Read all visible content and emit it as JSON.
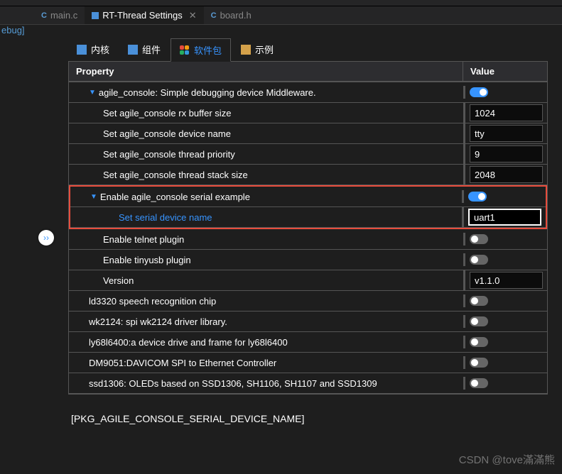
{
  "leftLabel": "ebug]",
  "fileTabs": [
    {
      "icon": "C",
      "label": "main.c",
      "closable": false,
      "active": false
    },
    {
      "icon": "RT",
      "label": "RT-Thread Settings",
      "closable": true,
      "active": true
    },
    {
      "icon": "C",
      "label": "board.h",
      "closable": false,
      "active": false
    }
  ],
  "navTabs": [
    {
      "label": "内核",
      "active": false
    },
    {
      "label": "组件",
      "active": false
    },
    {
      "label": "软件包",
      "active": true
    },
    {
      "label": "示例",
      "active": false
    }
  ],
  "headers": {
    "property": "Property",
    "value": "Value"
  },
  "rows": [
    {
      "id": "agile_console",
      "indent": 1,
      "arrow": true,
      "label": "agile_console: Simple debugging device Middleware.",
      "type": "toggle",
      "on": true
    },
    {
      "id": "rx_buf",
      "indent": 2,
      "label": "Set agile_console rx buffer size",
      "type": "input",
      "value": "1024"
    },
    {
      "id": "dev_name",
      "indent": 2,
      "label": "Set agile_console device name",
      "type": "input",
      "value": "tty"
    },
    {
      "id": "thread_prio",
      "indent": 2,
      "label": "Set agile_console thread priority",
      "type": "input",
      "value": "9"
    },
    {
      "id": "stack_size",
      "indent": 2,
      "label": "Set agile_console thread stack size",
      "type": "input",
      "value": "2048"
    },
    {
      "id": "serial_ex",
      "indent": 1,
      "arrow": true,
      "label": "Enable agile_console serial example",
      "type": "toggle",
      "on": true,
      "boxed": true
    },
    {
      "id": "serial_dev",
      "indent": 3,
      "label": "Set serial device name",
      "type": "input",
      "value": "uart1",
      "highlighted": true,
      "boxed": true,
      "focused": true
    },
    {
      "id": "telnet",
      "indent": 2,
      "label": "Enable telnet plugin",
      "type": "toggle",
      "on": false
    },
    {
      "id": "tinyusb",
      "indent": 2,
      "label": "Enable tinyusb plugin",
      "type": "toggle",
      "on": false
    },
    {
      "id": "version",
      "indent": 2,
      "label": "Version",
      "type": "input",
      "value": "v1.1.0"
    },
    {
      "id": "ld3320",
      "indent": 1,
      "label": "ld3320 speech recognition chip",
      "type": "toggle",
      "on": false
    },
    {
      "id": "wk2124",
      "indent": 1,
      "label": "wk2124: spi wk2124 driver library.",
      "type": "toggle",
      "on": false
    },
    {
      "id": "ly68l",
      "indent": 1,
      "label": "ly68l6400:a device drive and frame for ly68l6400",
      "type": "toggle",
      "on": false
    },
    {
      "id": "dm9051",
      "indent": 1,
      "label": "DM9051:DAVICOM SPI to Ethernet Controller",
      "type": "toggle",
      "on": false
    },
    {
      "id": "ssd1306",
      "indent": 1,
      "label": "ssd1306: OLEDs based on SSD1306, SH1106, SH1107 and SSD1309",
      "type": "toggle",
      "on": false
    }
  ],
  "circleBtn": "››",
  "footerKey": "[PKG_AGILE_CONSOLE_SERIAL_DEVICE_NAME]",
  "watermark": "CSDN @tove滿滿熊"
}
